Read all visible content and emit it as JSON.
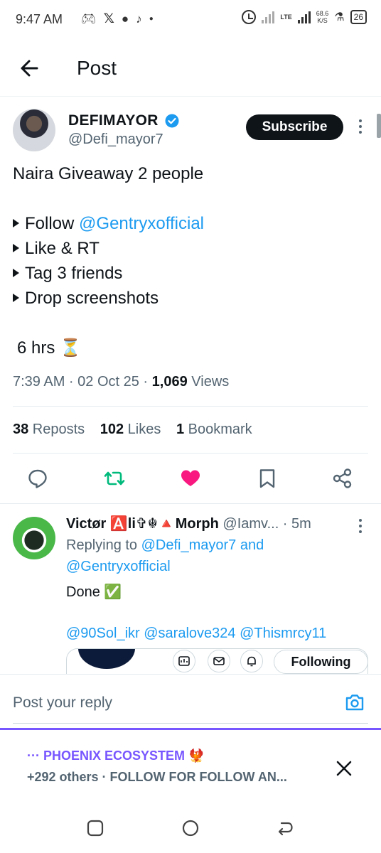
{
  "status_bar": {
    "time": "9:47 AM",
    "left_icons": [
      "gamepad-icon",
      "x-logo-icon",
      "chat-bubble-icon",
      "tiktok-icon",
      "dot-icon"
    ],
    "network": "LTE",
    "speed_value": "68.6",
    "speed_unit": "K/S",
    "battery": "26"
  },
  "header": {
    "title": "Post",
    "back_icon": "arrow-left-icon"
  },
  "post": {
    "author_name": "DEFIMAYOR",
    "author_handle": "@Defi_mayor7",
    "subscribe_label": "Subscribe",
    "line1": "Naira Giveaway 2 people",
    "bullets": [
      {
        "text": "Follow ",
        "mention": "@Gentryxofficial"
      },
      {
        "text": "Like & RT",
        "mention": ""
      },
      {
        "text": "Tag 3 friends",
        "mention": ""
      },
      {
        "text": "Drop screenshots",
        "mention": ""
      }
    ],
    "countdown": "6 hrs ⏳",
    "time": "7:39 AM · 02 Oct 25 · ",
    "views_count": "1,069",
    "views_label": " Views",
    "reposts_count": "38",
    "reposts_label": " Reposts",
    "likes_count": "102",
    "likes_label": " Likes",
    "bookmarks_count": "1",
    "bookmarks_label": " Bookmark",
    "actions": [
      "reply-icon",
      "repost-icon",
      "like-icon",
      "bookmark-icon",
      "share-icon"
    ],
    "accent_colors": {
      "repost": "#00ba7c",
      "like": "#f91880",
      "link": "#1d9bf0"
    }
  },
  "reply": {
    "name": "Victør 🅰️li✞☬🔺Morph",
    "handle_time": " @Iamv... · 5m",
    "replying_prefix": "Replying to ",
    "replying_mention1": "@Defi_mayor7",
    "replying_and": " and",
    "replying_mention2": "@Gentryxofficial",
    "text": "Done ✅",
    "mentions": "@90Sol_ikr @saralove324 @Thismrcy11",
    "following_label": "Following"
  },
  "composer": {
    "placeholder": "Post your reply"
  },
  "banner": {
    "title": "··· PHOENIX ECOSYSTEM 🐦‍🔥",
    "subtitle": "+292 others · FOLLOW FOR FOLLOW AN..."
  }
}
